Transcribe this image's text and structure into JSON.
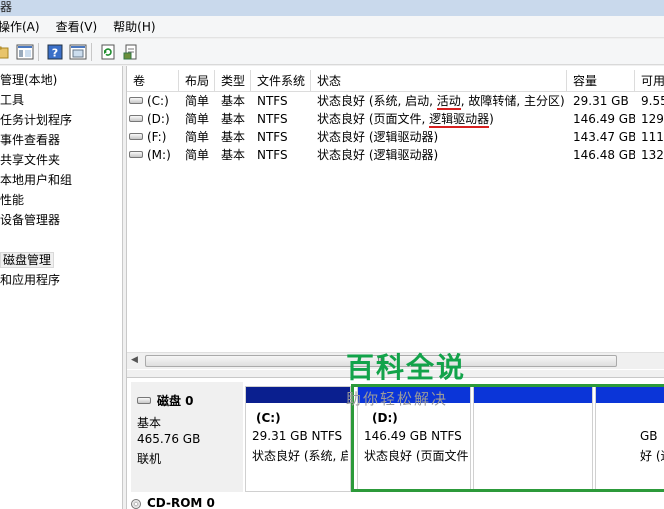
{
  "title_bar": {
    "text": "器"
  },
  "menu": {
    "items": [
      "操作(A)",
      "查看(V)",
      "帮助(H)"
    ]
  },
  "toolbar": {
    "icons": [
      "folder-up-icon",
      "show-hide-tree-icon",
      "help-icon",
      "properties-icon",
      "refresh-icon",
      "export-icon"
    ]
  },
  "tree": {
    "items": [
      "管理(本地)",
      "工具",
      "任务计划程序",
      "事件查看器",
      "共享文件夹",
      "本地用户和组",
      "性能",
      "设备管理器",
      "",
      "磁盘管理",
      "和应用程序"
    ]
  },
  "volume_table": {
    "columns": [
      "卷",
      "布局",
      "类型",
      "文件系统",
      "状态",
      "容量",
      "可用"
    ],
    "rows": [
      {
        "volume": "(C:)",
        "layout": "简单",
        "type": "基本",
        "fs": "NTFS",
        "status_a": "状态良好 (系统, 启动, ",
        "status_active": "活动",
        "status_b": ", 故障转储, 主分区)",
        "capacity": "29.31 GB",
        "free": "9.55"
      },
      {
        "volume": "(D:)",
        "layout": "简单",
        "type": "基本",
        "fs": "NTFS",
        "status_a": "状态良好 (页面文件, ",
        "status_active": "逻辑驱动器",
        "status_b": ")",
        "capacity": "146.49 GB",
        "free": "129"
      },
      {
        "volume": "(F:)",
        "layout": "简单",
        "type": "基本",
        "fs": "NTFS",
        "status_a": "状态良好 (逻辑驱动器)",
        "status_active": "",
        "status_b": "",
        "capacity": "143.47 GB",
        "free": "111"
      },
      {
        "volume": "(M:)",
        "layout": "简单",
        "type": "基本",
        "fs": "NTFS",
        "status_a": "状态良好 (逻辑驱动器)",
        "status_active": "",
        "status_b": "",
        "capacity": "146.48 GB",
        "free": "132"
      }
    ],
    "scroll_thumb": "III"
  },
  "disk": {
    "name": "磁盘 0",
    "kind": "基本",
    "size": "465.76 GB",
    "state": "联机",
    "partitions": [
      {
        "name": "(C:)",
        "size": "29.31 GB NTFS",
        "status": "状态良好 (系统, 启"
      },
      {
        "name": "(D:)",
        "size": "146.49 GB NTFS",
        "status": "状态良好 (页面文件"
      },
      {
        "name": "",
        "size": "",
        "status": ""
      },
      {
        "name": "",
        "size": "GB",
        "status": "好 (逻"
      }
    ]
  },
  "cdrom": {
    "label": "CD-ROM 0"
  },
  "watermark": {
    "title": "百科全说",
    "subtitle": "助你轻松解决"
  },
  "colors": {
    "primary_bar": "#0a1f8f",
    "logical_bar": "#0b35d8",
    "selection_frame": "#2c9a3a",
    "watermark": "#12a34a"
  }
}
